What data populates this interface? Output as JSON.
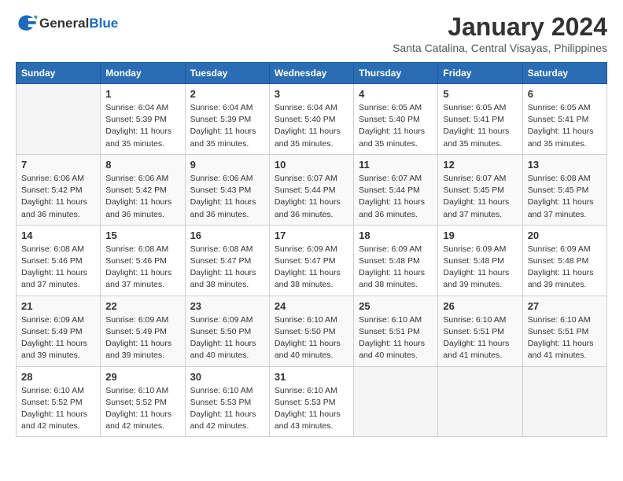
{
  "header": {
    "logo_general": "General",
    "logo_blue": "Blue",
    "title": "January 2024",
    "subtitle": "Santa Catalina, Central Visayas, Philippines"
  },
  "weekdays": [
    "Sunday",
    "Monday",
    "Tuesday",
    "Wednesday",
    "Thursday",
    "Friday",
    "Saturday"
  ],
  "weeks": [
    [
      {
        "day": "",
        "info": ""
      },
      {
        "day": "1",
        "info": "Sunrise: 6:04 AM\nSunset: 5:39 PM\nDaylight: 11 hours\nand 35 minutes."
      },
      {
        "day": "2",
        "info": "Sunrise: 6:04 AM\nSunset: 5:39 PM\nDaylight: 11 hours\nand 35 minutes."
      },
      {
        "day": "3",
        "info": "Sunrise: 6:04 AM\nSunset: 5:40 PM\nDaylight: 11 hours\nand 35 minutes."
      },
      {
        "day": "4",
        "info": "Sunrise: 6:05 AM\nSunset: 5:40 PM\nDaylight: 11 hours\nand 35 minutes."
      },
      {
        "day": "5",
        "info": "Sunrise: 6:05 AM\nSunset: 5:41 PM\nDaylight: 11 hours\nand 35 minutes."
      },
      {
        "day": "6",
        "info": "Sunrise: 6:05 AM\nSunset: 5:41 PM\nDaylight: 11 hours\nand 35 minutes."
      }
    ],
    [
      {
        "day": "7",
        "info": "Sunrise: 6:06 AM\nSunset: 5:42 PM\nDaylight: 11 hours\nand 36 minutes."
      },
      {
        "day": "8",
        "info": "Sunrise: 6:06 AM\nSunset: 5:42 PM\nDaylight: 11 hours\nand 36 minutes."
      },
      {
        "day": "9",
        "info": "Sunrise: 6:06 AM\nSunset: 5:43 PM\nDaylight: 11 hours\nand 36 minutes."
      },
      {
        "day": "10",
        "info": "Sunrise: 6:07 AM\nSunset: 5:44 PM\nDaylight: 11 hours\nand 36 minutes."
      },
      {
        "day": "11",
        "info": "Sunrise: 6:07 AM\nSunset: 5:44 PM\nDaylight: 11 hours\nand 36 minutes."
      },
      {
        "day": "12",
        "info": "Sunrise: 6:07 AM\nSunset: 5:45 PM\nDaylight: 11 hours\nand 37 minutes."
      },
      {
        "day": "13",
        "info": "Sunrise: 6:08 AM\nSunset: 5:45 PM\nDaylight: 11 hours\nand 37 minutes."
      }
    ],
    [
      {
        "day": "14",
        "info": "Sunrise: 6:08 AM\nSunset: 5:46 PM\nDaylight: 11 hours\nand 37 minutes."
      },
      {
        "day": "15",
        "info": "Sunrise: 6:08 AM\nSunset: 5:46 PM\nDaylight: 11 hours\nand 37 minutes."
      },
      {
        "day": "16",
        "info": "Sunrise: 6:08 AM\nSunset: 5:47 PM\nDaylight: 11 hours\nand 38 minutes."
      },
      {
        "day": "17",
        "info": "Sunrise: 6:09 AM\nSunset: 5:47 PM\nDaylight: 11 hours\nand 38 minutes."
      },
      {
        "day": "18",
        "info": "Sunrise: 6:09 AM\nSunset: 5:48 PM\nDaylight: 11 hours\nand 38 minutes."
      },
      {
        "day": "19",
        "info": "Sunrise: 6:09 AM\nSunset: 5:48 PM\nDaylight: 11 hours\nand 39 minutes."
      },
      {
        "day": "20",
        "info": "Sunrise: 6:09 AM\nSunset: 5:48 PM\nDaylight: 11 hours\nand 39 minutes."
      }
    ],
    [
      {
        "day": "21",
        "info": "Sunrise: 6:09 AM\nSunset: 5:49 PM\nDaylight: 11 hours\nand 39 minutes."
      },
      {
        "day": "22",
        "info": "Sunrise: 6:09 AM\nSunset: 5:49 PM\nDaylight: 11 hours\nand 39 minutes."
      },
      {
        "day": "23",
        "info": "Sunrise: 6:09 AM\nSunset: 5:50 PM\nDaylight: 11 hours\nand 40 minutes."
      },
      {
        "day": "24",
        "info": "Sunrise: 6:10 AM\nSunset: 5:50 PM\nDaylight: 11 hours\nand 40 minutes."
      },
      {
        "day": "25",
        "info": "Sunrise: 6:10 AM\nSunset: 5:51 PM\nDaylight: 11 hours\nand 40 minutes."
      },
      {
        "day": "26",
        "info": "Sunrise: 6:10 AM\nSunset: 5:51 PM\nDaylight: 11 hours\nand 41 minutes."
      },
      {
        "day": "27",
        "info": "Sunrise: 6:10 AM\nSunset: 5:51 PM\nDaylight: 11 hours\nand 41 minutes."
      }
    ],
    [
      {
        "day": "28",
        "info": "Sunrise: 6:10 AM\nSunset: 5:52 PM\nDaylight: 11 hours\nand 42 minutes."
      },
      {
        "day": "29",
        "info": "Sunrise: 6:10 AM\nSunset: 5:52 PM\nDaylight: 11 hours\nand 42 minutes."
      },
      {
        "day": "30",
        "info": "Sunrise: 6:10 AM\nSunset: 5:53 PM\nDaylight: 11 hours\nand 42 minutes."
      },
      {
        "day": "31",
        "info": "Sunrise: 6:10 AM\nSunset: 5:53 PM\nDaylight: 11 hours\nand 43 minutes."
      },
      {
        "day": "",
        "info": ""
      },
      {
        "day": "",
        "info": ""
      },
      {
        "day": "",
        "info": ""
      }
    ]
  ]
}
